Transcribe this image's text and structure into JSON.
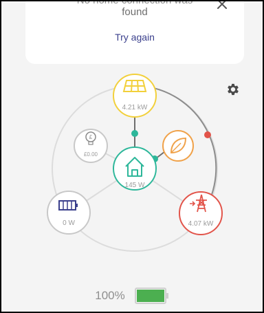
{
  "banner": {
    "message_line1": "No home connection was",
    "message_line2": "found",
    "retry_label": "Try again"
  },
  "flow": {
    "solar": {
      "value": "4.21 kW",
      "icon": "solar-panel-icon"
    },
    "home": {
      "value": "145 W",
      "icon": "house-icon"
    },
    "grid": {
      "value": "4.07 kW",
      "icon": "pylon-icon"
    },
    "battery": {
      "value": "0 W",
      "icon": "battery-icon"
    },
    "savings": {
      "value": "£0.00",
      "icon": "lightbulb-pound-icon"
    },
    "eco": {
      "icon": "leaf-icon"
    }
  },
  "status": {
    "battery_percent": "100%",
    "battery_level": 1.0
  },
  "colors": {
    "solar": "#f2d03b",
    "home": "#2db79a",
    "grid": "#e2544a",
    "eco": "#f0a24a",
    "battery_fill": "#4caf50"
  }
}
